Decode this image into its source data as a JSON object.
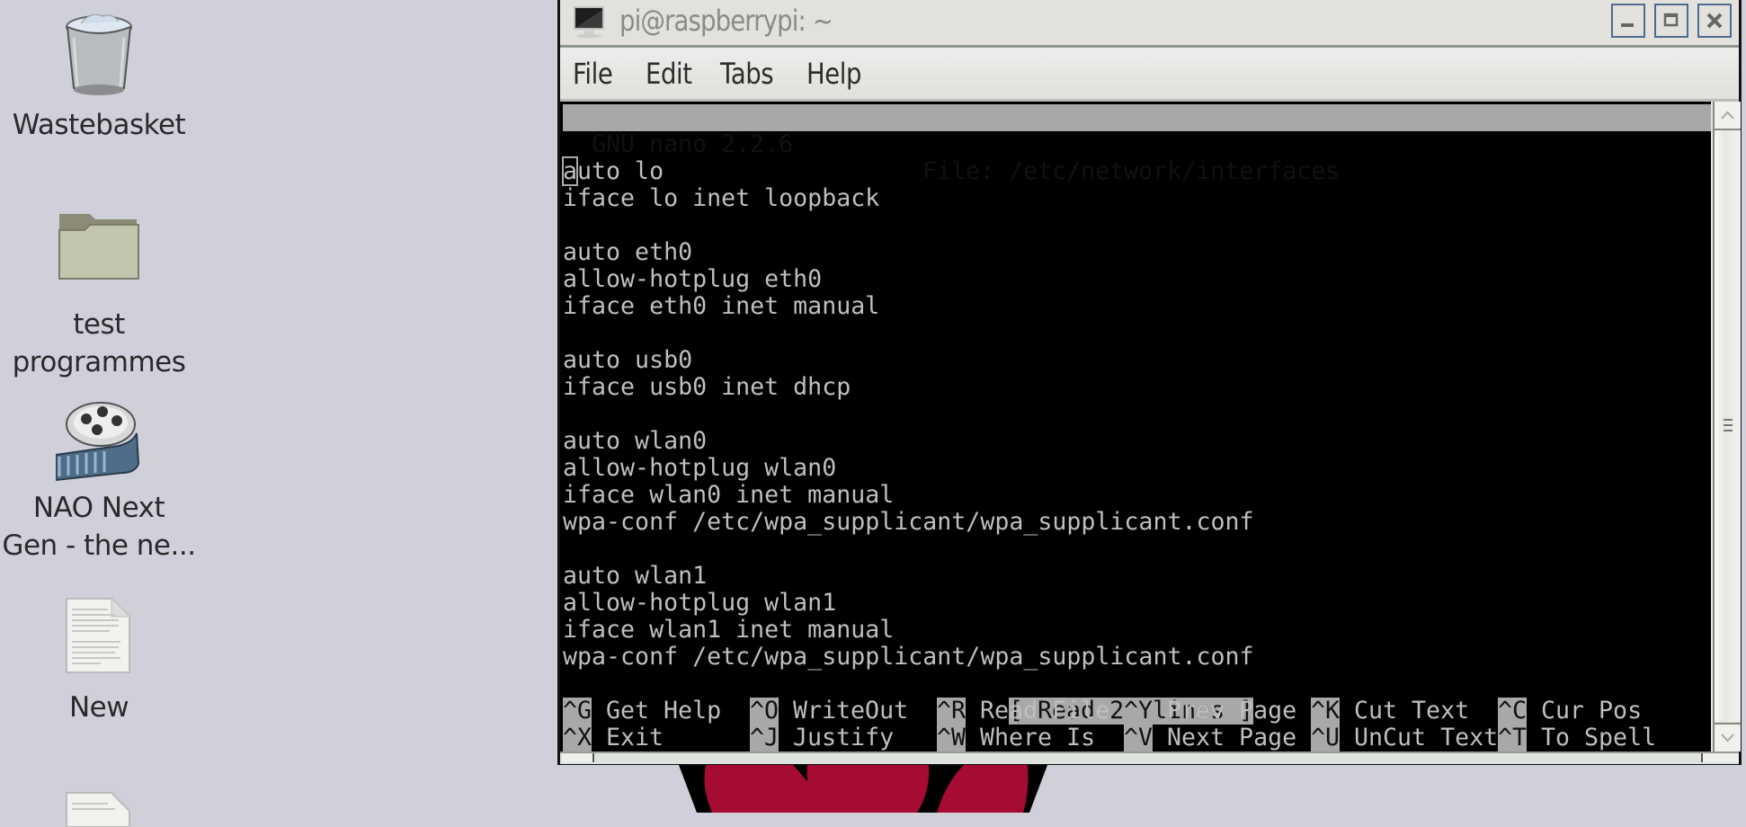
{
  "desktop": {
    "icons": [
      {
        "label": "Wastebasket",
        "icon": "trash-icon"
      },
      {
        "label_line1": "test",
        "label_line2": "programmes",
        "icon": "folder-icon"
      },
      {
        "label_line1": "NAO Next",
        "label_line2": "Gen - the ne...",
        "icon": "video-file-icon"
      },
      {
        "label": "New",
        "icon": "text-file-icon"
      },
      {
        "icon": "text-file-icon"
      }
    ],
    "wallpaper_logo": "raspberry-pi-logo",
    "colors": {
      "background": "#cfd0da",
      "raspberry": "#a50b33"
    }
  },
  "window": {
    "title": "pi@raspberrypi: ~",
    "buttons": {
      "minimize": "minimize",
      "maximize": "maximize",
      "close": "close"
    },
    "menu": [
      "File",
      "Edit",
      "Tabs",
      "Help"
    ]
  },
  "nano": {
    "version": "GNU nano 2.2.6",
    "file_label": "File: /etc/network/interfaces",
    "lines": [
      "",
      "auto lo",
      "iface lo inet loopback",
      "",
      "auto eth0",
      "allow-hotplug eth0",
      "iface eth0 inet manual",
      "",
      "auto usb0",
      "iface usb0 inet dhcp",
      "",
      "auto wlan0",
      "allow-hotplug wlan0",
      "iface wlan0 inet manual",
      "wpa-conf /etc/wpa_supplicant/wpa_supplicant.conf",
      "",
      "auto wlan1",
      "allow-hotplug wlan1",
      "iface wlan1 inet manual",
      "wpa-conf /etc/wpa_supplicant/wpa_supplicant.conf"
    ],
    "status": "[ Read 20 lines ]",
    "shortcuts_row1": [
      {
        "key": "^G",
        "label": "Get Help"
      },
      {
        "key": "^O",
        "label": "WriteOut"
      },
      {
        "key": "^R",
        "label": "Read File"
      },
      {
        "key": "^Y",
        "label": "Prev Page"
      },
      {
        "key": "^K",
        "label": "Cut Text"
      },
      {
        "key": "^C",
        "label": "Cur Pos"
      }
    ],
    "shortcuts_row2": [
      {
        "key": "^X",
        "label": "Exit"
      },
      {
        "key": "^J",
        "label": "Justify"
      },
      {
        "key": "^W",
        "label": "Where Is"
      },
      {
        "key": "^V",
        "label": "Next Page"
      },
      {
        "key": "^U",
        "label": "UnCut Text"
      },
      {
        "key": "^T",
        "label": "To Spell"
      }
    ]
  }
}
